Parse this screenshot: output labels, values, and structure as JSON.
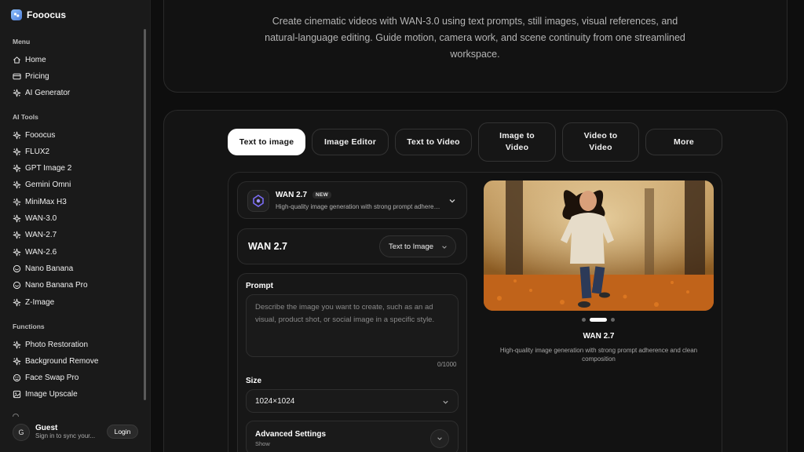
{
  "brand": {
    "name": "Fooocus",
    "icon": "fooocus-logo-icon"
  },
  "sidebar": {
    "sections": [
      {
        "label": "Menu",
        "items": [
          {
            "label": "Home",
            "icon": "home-icon"
          },
          {
            "label": "Pricing",
            "icon": "credit-card-icon"
          },
          {
            "label": "AI Generator",
            "icon": "sparkle-icon"
          }
        ]
      },
      {
        "label": "AI Tools",
        "items": [
          {
            "label": "Fooocus",
            "icon": "sparkle-icon"
          },
          {
            "label": "FLUX2",
            "icon": "sparkle-icon"
          },
          {
            "label": "GPT Image 2",
            "icon": "sparkle-icon"
          },
          {
            "label": "Gemini Omni",
            "icon": "sparkle-icon"
          },
          {
            "label": "MiniMax H3",
            "icon": "sparkle-icon"
          },
          {
            "label": "WAN-3.0",
            "icon": "sparkle-icon"
          },
          {
            "label": "WAN-2.7",
            "icon": "sparkle-icon"
          },
          {
            "label": "WAN-2.6",
            "icon": "sparkle-icon"
          },
          {
            "label": "Nano Banana",
            "icon": "banana-icon"
          },
          {
            "label": "Nano Banana Pro",
            "icon": "banana-icon"
          },
          {
            "label": "Z-Image",
            "icon": "sparkle-icon"
          }
        ]
      },
      {
        "label": "Functions",
        "items": [
          {
            "label": "Photo Restoration",
            "icon": "sparkle-icon"
          },
          {
            "label": "Background Remove",
            "icon": "sparkle-icon"
          },
          {
            "label": "Face Swap Pro",
            "icon": "face-icon"
          },
          {
            "label": "Image Upscale",
            "icon": "image-icon"
          }
        ]
      }
    ],
    "user": {
      "avatar": "G",
      "name": "Guest",
      "subtitle": "Sign in to sync your...",
      "login_label": "Login"
    }
  },
  "hero": {
    "description": "Create cinematic videos with WAN-3.0 using text prompts, still images, visual references, and natural-language editing. Guide motion, camera work, and scene continuity from one streamlined workspace."
  },
  "tabs": [
    {
      "label": "Text to image",
      "active": true
    },
    {
      "label": "Image Editor",
      "active": false
    },
    {
      "label": "Text to Video",
      "active": false
    },
    {
      "label": "Image to Video",
      "active": false
    },
    {
      "label": "Video to Video",
      "active": false
    },
    {
      "label": "More",
      "active": false
    }
  ],
  "model": {
    "name": "WAN 2.7",
    "badge": "NEW",
    "description": "High-quality image generation with strong prompt adherence and clean composition"
  },
  "mode": {
    "title": "WAN 2.7",
    "selected": "Text to Image"
  },
  "form": {
    "prompt_label": "Prompt",
    "prompt_placeholder": "Describe the image you want to create, such as an ad visual, product shot, or social image in a specific style.",
    "char_count": "0/1000",
    "size_label": "Size",
    "size_value": "1024×1024",
    "advanced_title": "Advanced Settings",
    "advanced_sub": "Show"
  },
  "preview": {
    "title": "WAN 2.7",
    "description": "High-quality image generation with strong prompt adherence and clean composition",
    "image_subject": "girl running in autumn park",
    "dot_count": 3,
    "active_dot": 1
  },
  "colors": {
    "background": "#0e0e0e",
    "sidebar": "#1a1a1a",
    "active_tab": "#ffffff",
    "accent": "#4b7bd6"
  }
}
